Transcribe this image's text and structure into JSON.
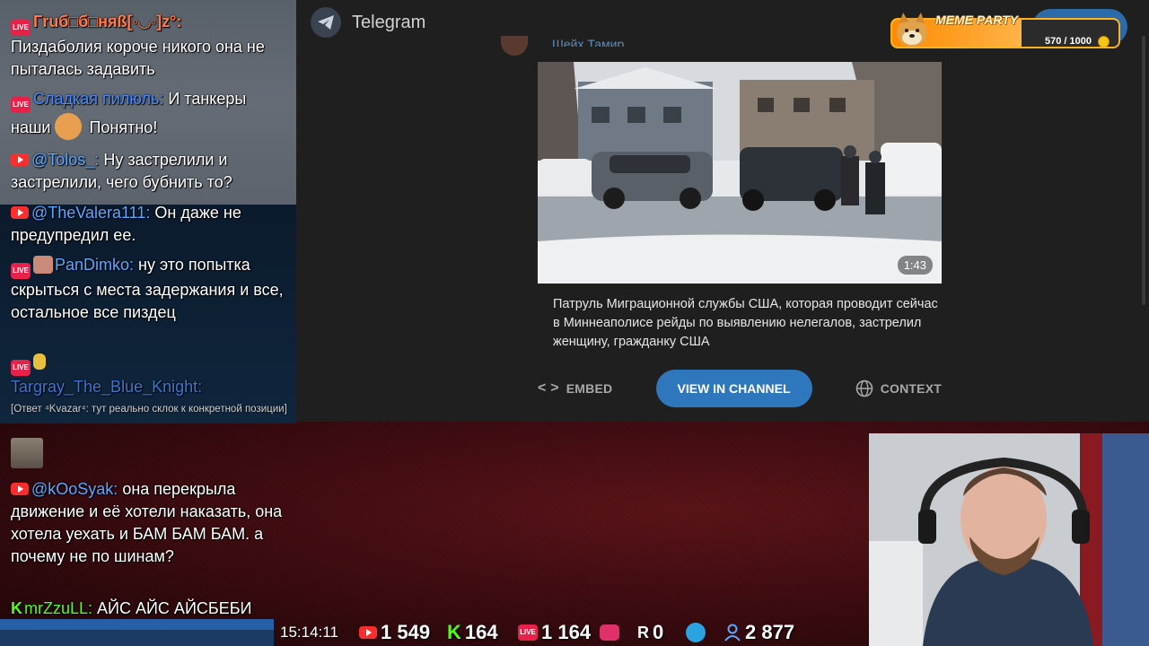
{
  "telegram": {
    "app_title": "Telegram",
    "post_author": "Шейх Тамир",
    "video_duration": "1:43",
    "post_text": "Патруль Миграционной службы США, которая проводит сейчас в Миннеаполисе рейды по выявлению нелегалов, застрелил женщину, гражданку США",
    "embed_label": "EMBED",
    "view_channel_label": "VIEW IN CHANNEL",
    "context_label": "CONTEXT"
  },
  "meme_party": {
    "title": "MEME PARTY",
    "count": "570 / 1000",
    "progress": 0.57
  },
  "chat": {
    "messages": [
      {
        "platform": "live",
        "nick": "Гruб□б□няß[◦◡◦]z°:",
        "nick_color": "#ff7a4a",
        "text": "Пиздаболия короче никого она не пыталась задавить"
      },
      {
        "platform": "live",
        "nick": "Сладкая пилюль:",
        "nick_color": "#4a8cff",
        "text": "И танкеры наши",
        "text_after_emote": "Понятно!"
      },
      {
        "platform": "youtube",
        "nick": "@Tolos_:",
        "nick_color": "#5aa8ff",
        "text": "Ну застрелили и застрелили, чего бубнить то?"
      },
      {
        "platform": "youtube",
        "nick": "@TheValera111:",
        "nick_color": "#5aa8ff",
        "text": "Он даже не предупредил ее."
      },
      {
        "platform": "live",
        "nick": "PanDimko:",
        "nick_color": "#5aa8ff",
        "text": "ну это попытка скрыться с места задержания и все, остальное все пиздец"
      },
      {
        "platform": "live",
        "nick": "Targray_The_Blue_Knight:",
        "nick_color": "#3a78d8",
        "text": ""
      },
      {
        "platform": "youtube",
        "nick": "@kOoSyak:",
        "nick_color": "#5aa8ff",
        "text": "она перекрыла движение и её хотели наказать, она хотела уехать и БАМ БАМ БАМ. а почему не по шинам?"
      },
      {
        "platform": "kick",
        "nick": "mrZzuLL:",
        "nick_color": "#53fc18",
        "text": "АЙС АЙС АЙСБЕБИ"
      }
    ],
    "reply_text": "[Ответ ⁴Kvazar⁴: тут реально склок к конкретной позиции]"
  },
  "stats": {
    "time": "15:14:11",
    "youtube": "1 549",
    "kick": "164",
    "live": "1 164",
    "rutube": "0",
    "telegram": "",
    "viewers": "2 877"
  },
  "colors": {
    "accent": "#2f77bd",
    "live": "#e8214a",
    "youtube": "#ff2d2d",
    "kick": "#53fc18"
  }
}
